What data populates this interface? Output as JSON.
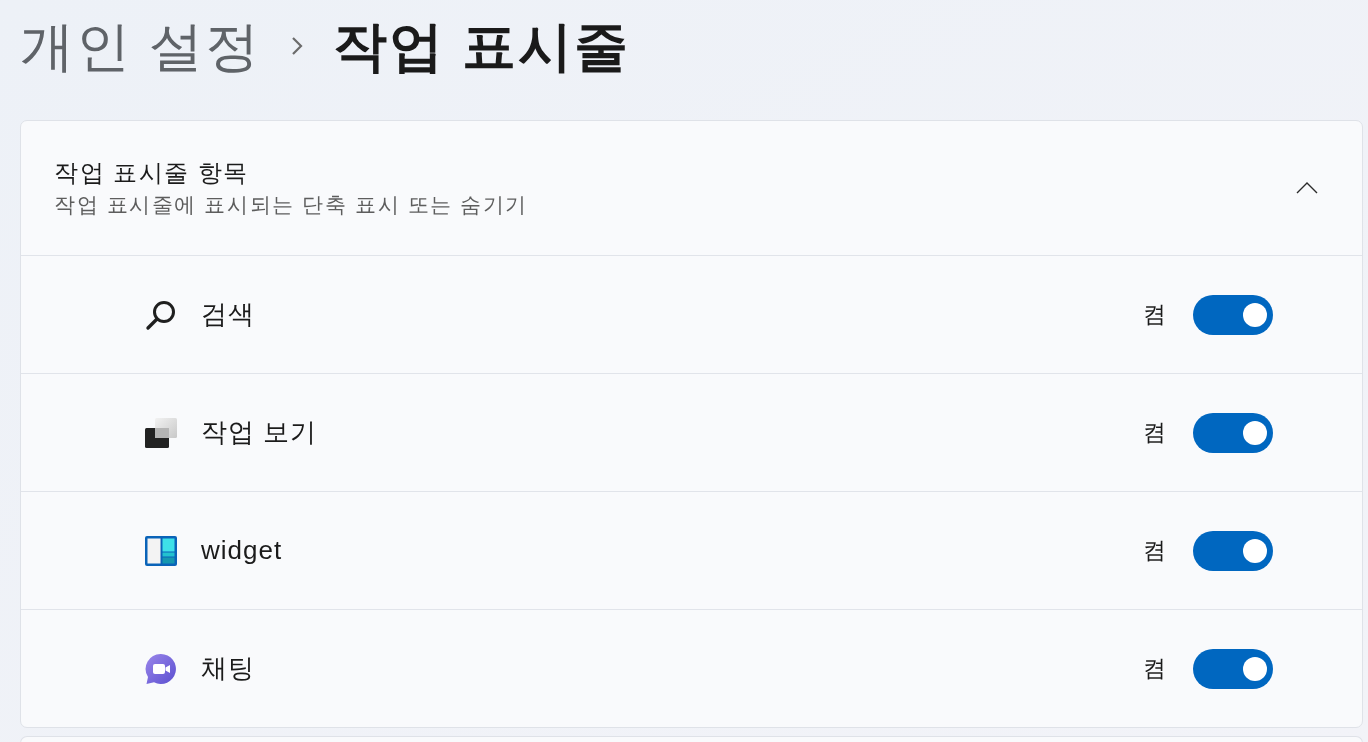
{
  "breadcrumb": [
    {
      "label": "개인 설정",
      "current": false
    },
    {
      "label": "작업 표시줄",
      "current": true
    }
  ],
  "section": {
    "title": "작업 표시줄 항목",
    "subtitle": "작업 표시줄에 표시되는 단축 표시 또는 숨기기",
    "expanded": true,
    "items": [
      {
        "label": "검색",
        "status": "켬",
        "on": true
      },
      {
        "label": "작업 보기",
        "status": "켬",
        "on": true
      },
      {
        "label": "widget",
        "status": "켬",
        "on": true
      },
      {
        "label": "채팅",
        "status": "켬",
        "on": true
      }
    ]
  }
}
